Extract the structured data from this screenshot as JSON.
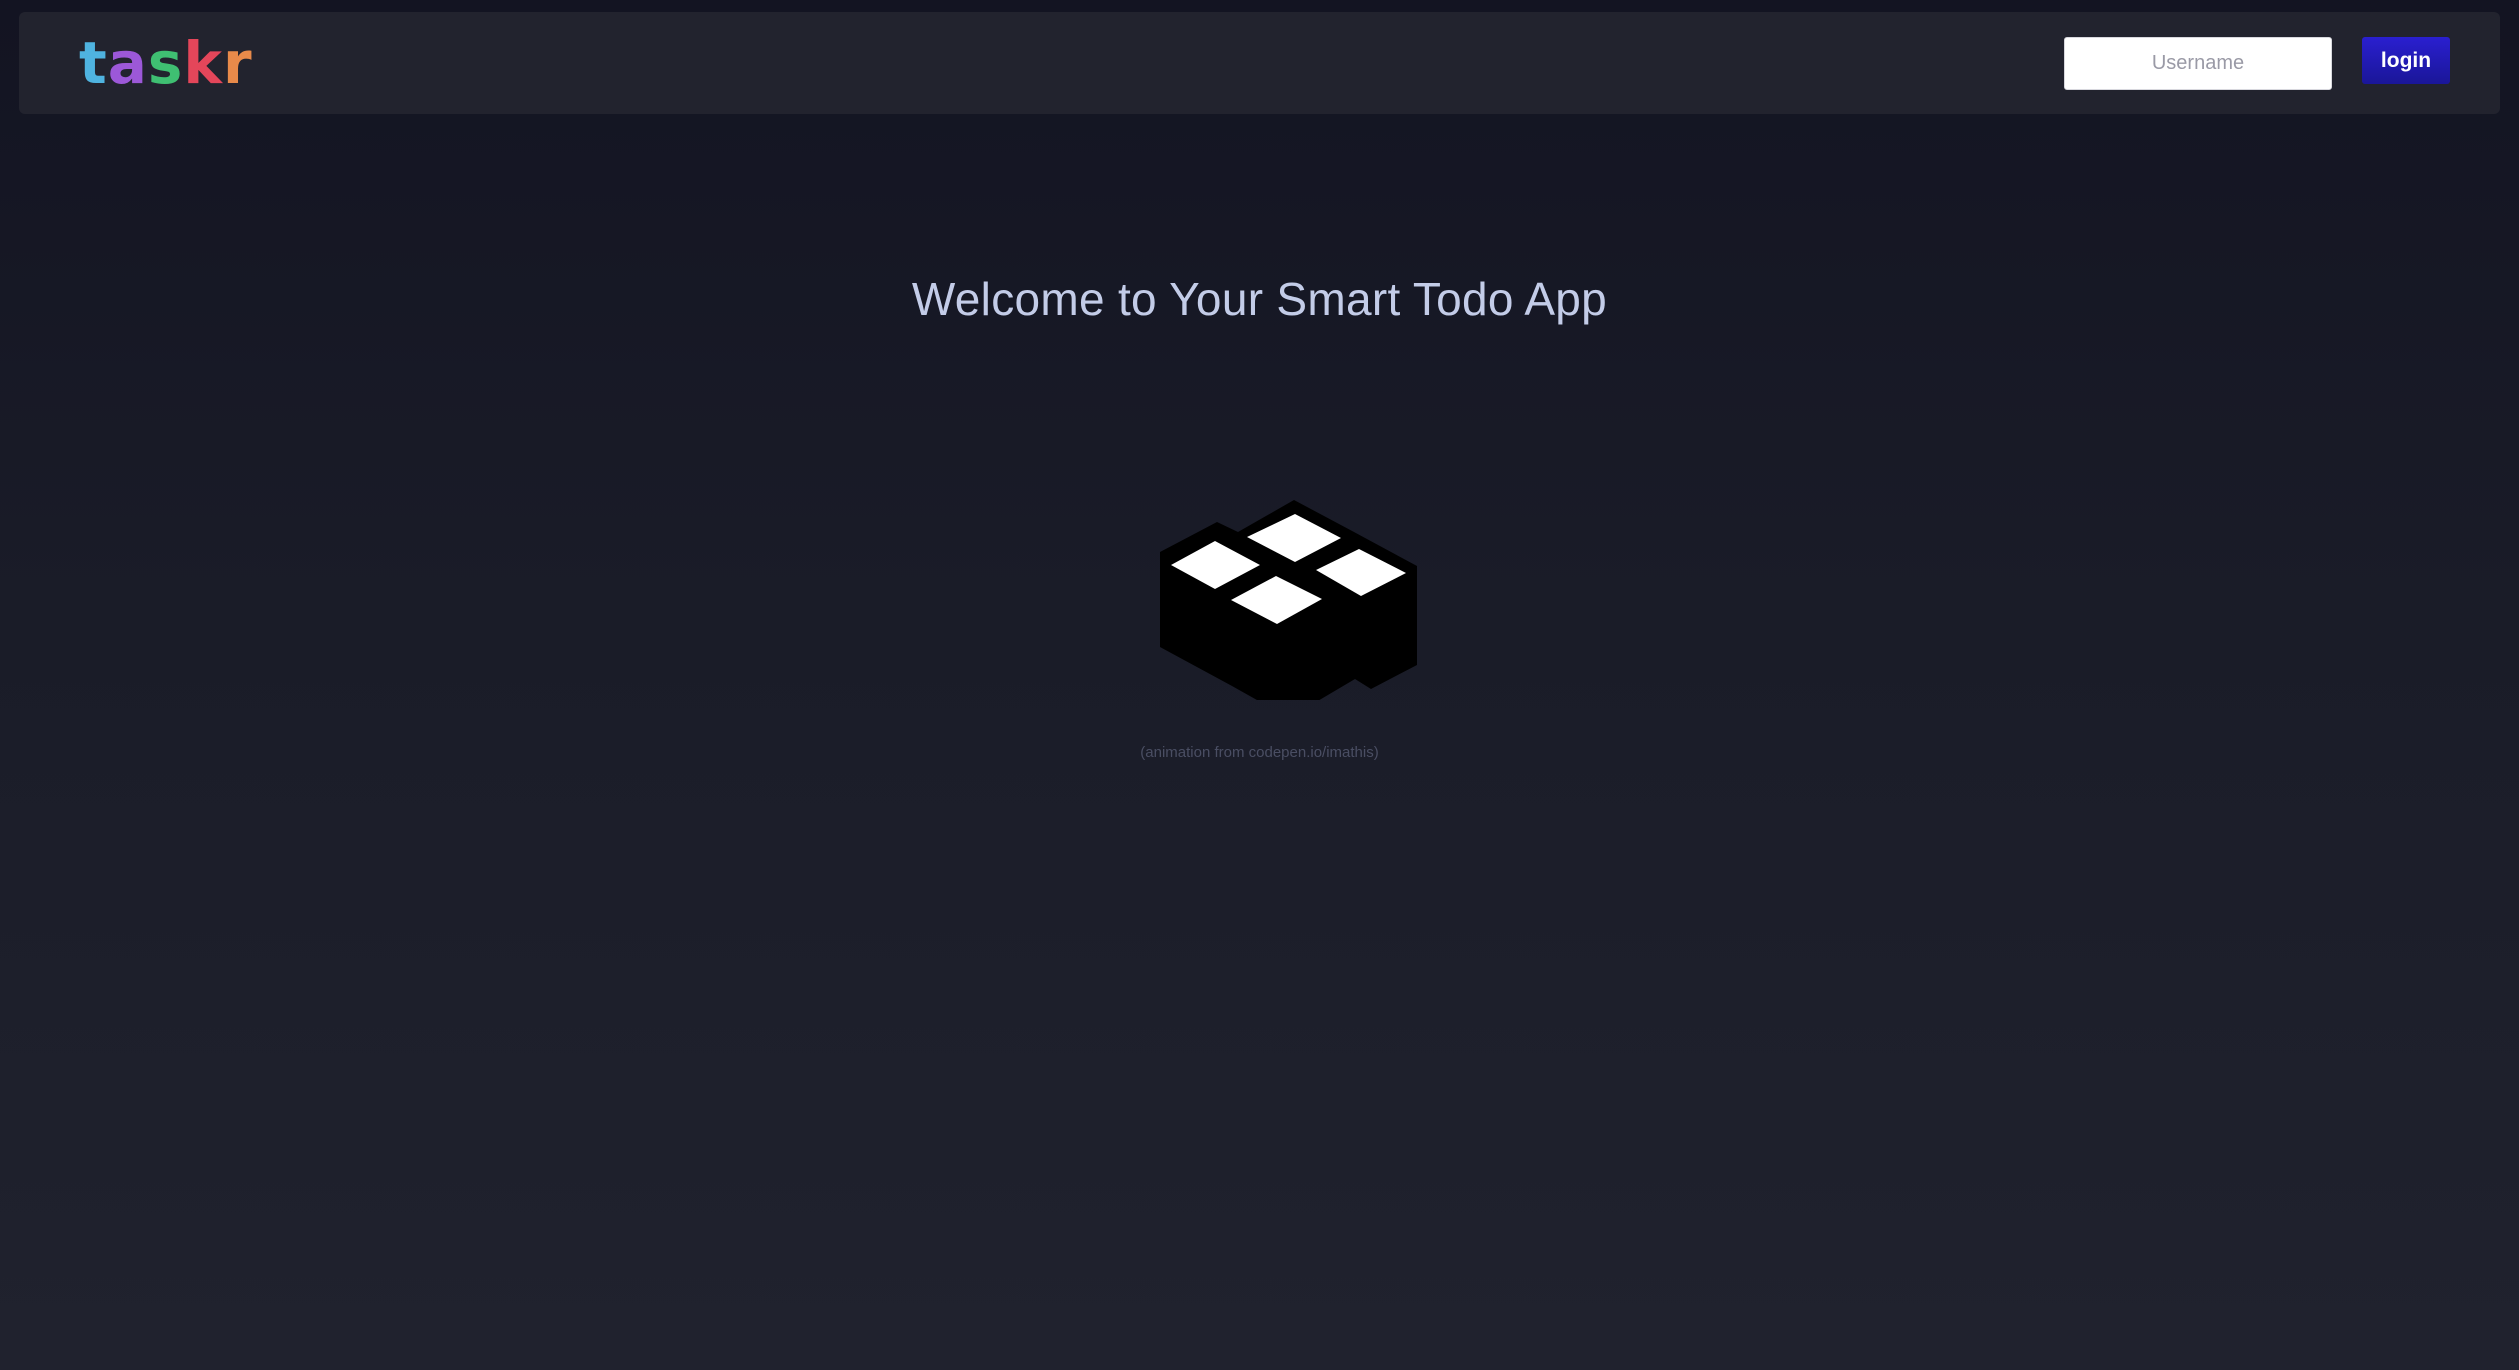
{
  "header": {
    "logo_letters": [
      {
        "char": "t",
        "color": "#4fb3e0"
      },
      {
        "char": "a",
        "color": "#9c58d8"
      },
      {
        "char": "s",
        "color": "#3fbf72"
      },
      {
        "char": "k",
        "color": "#e4465a"
      },
      {
        "char": "r",
        "color": "#e88a4a"
      }
    ],
    "username_placeholder": "Username",
    "username_value": "",
    "login_label": "login"
  },
  "main": {
    "title": "Welcome to Your Smart Todo App",
    "loader_icon": "isometric-blocks-icon",
    "credit": "(animation from codepen.io/imathis)"
  },
  "colors": {
    "navbar_bg": "#22232e",
    "login_button": "#2a1fd0",
    "title_text": "#c3cce8"
  }
}
